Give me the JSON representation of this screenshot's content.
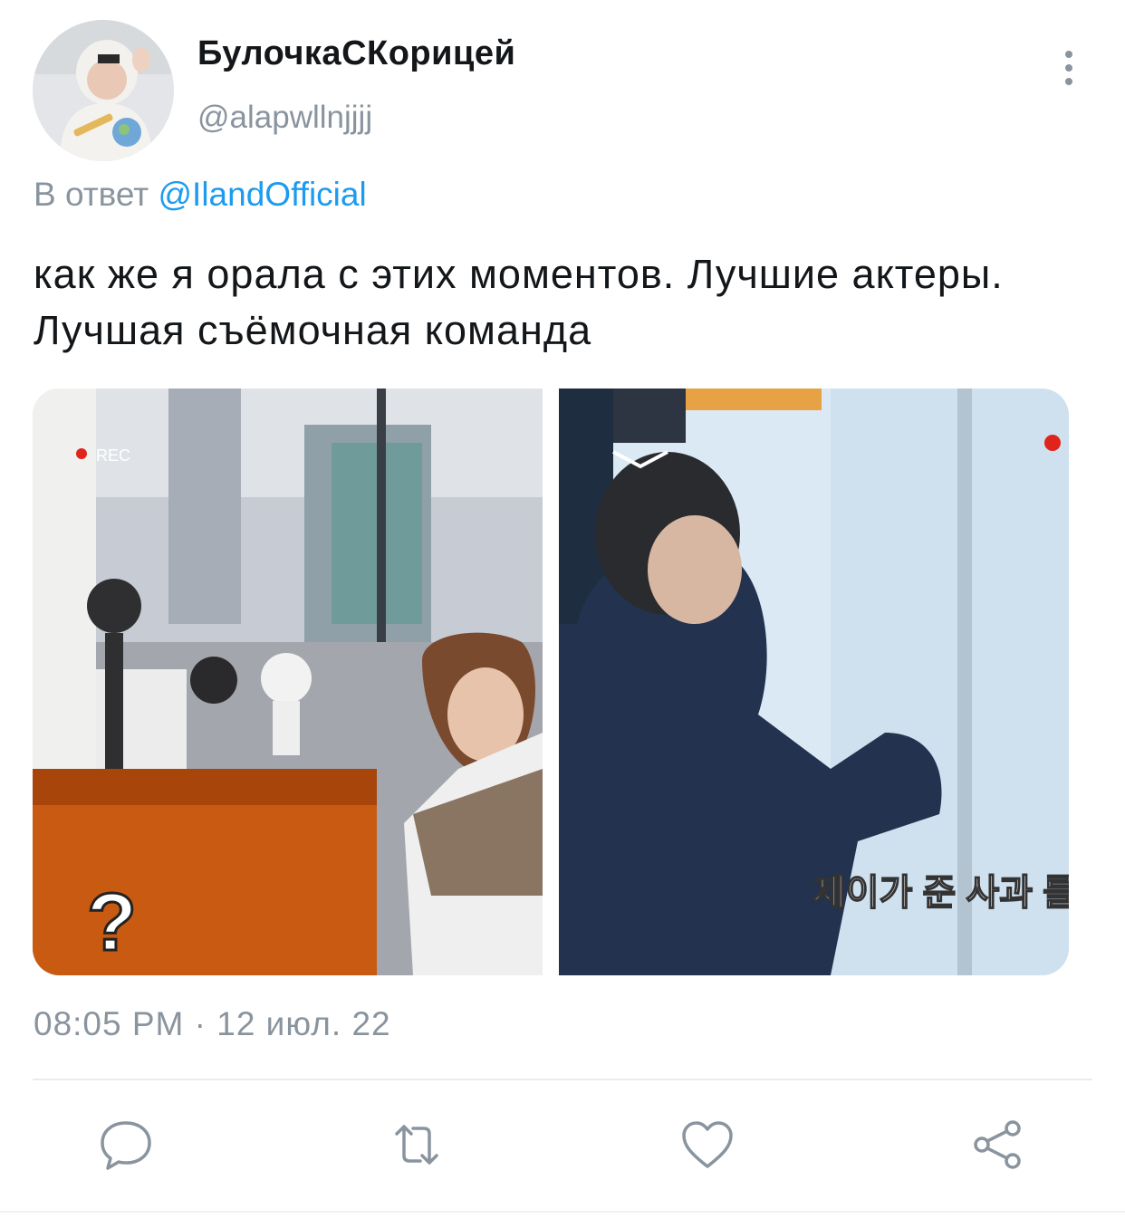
{
  "tweet": {
    "display_name": "БулочкаСКорицей",
    "handle": "@alapwllnjjjj",
    "reply_prefix": "В ответ",
    "reply_mention": "@IlandOfficial",
    "text": "как же я орала с этих моментов. Лучшие актеры. Лучшая съёмочная команда",
    "timestamp": "08:05 PM · 12 июл. 22"
  },
  "media": {
    "left": {
      "rec_label": "REC",
      "overlay_mark": "?"
    },
    "right": {
      "caption": "제이가 준 사과 를"
    }
  },
  "actions": [
    {
      "name": "reply",
      "icon": "comment-icon"
    },
    {
      "name": "retweet",
      "icon": "retweet-icon"
    },
    {
      "name": "like",
      "icon": "heart-icon"
    },
    {
      "name": "share",
      "icon": "share-icon"
    }
  ],
  "colors": {
    "link": "#1d9bf0",
    "muted": "#8a949e",
    "text": "#14171a"
  }
}
